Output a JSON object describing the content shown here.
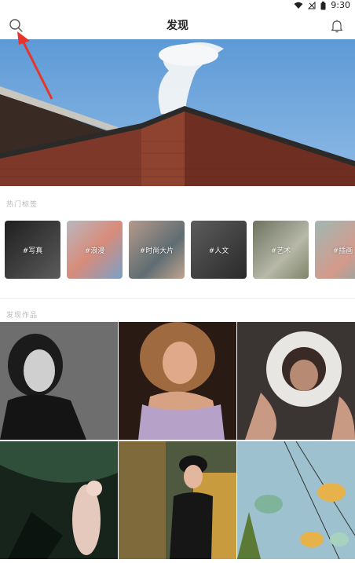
{
  "status": {
    "time": "9:30"
  },
  "header": {
    "title": "发现"
  },
  "hot_tags_title": "热门标签",
  "discover_title": "发现作品",
  "tags": [
    {
      "label": "#写真"
    },
    {
      "label": "#浪漫"
    },
    {
      "label": "#时尚大片"
    },
    {
      "label": "#人文"
    },
    {
      "label": "#艺术"
    },
    {
      "label": "#插画"
    }
  ],
  "icons": {
    "search": "search-icon",
    "bell": "bell-icon",
    "wifi": "wifi-icon",
    "signal": "signal-icon",
    "battery": "battery-icon"
  },
  "colors": {
    "accent": "#e8342a",
    "sky": "#6aa3d9",
    "brick": "#8a3f2e"
  }
}
